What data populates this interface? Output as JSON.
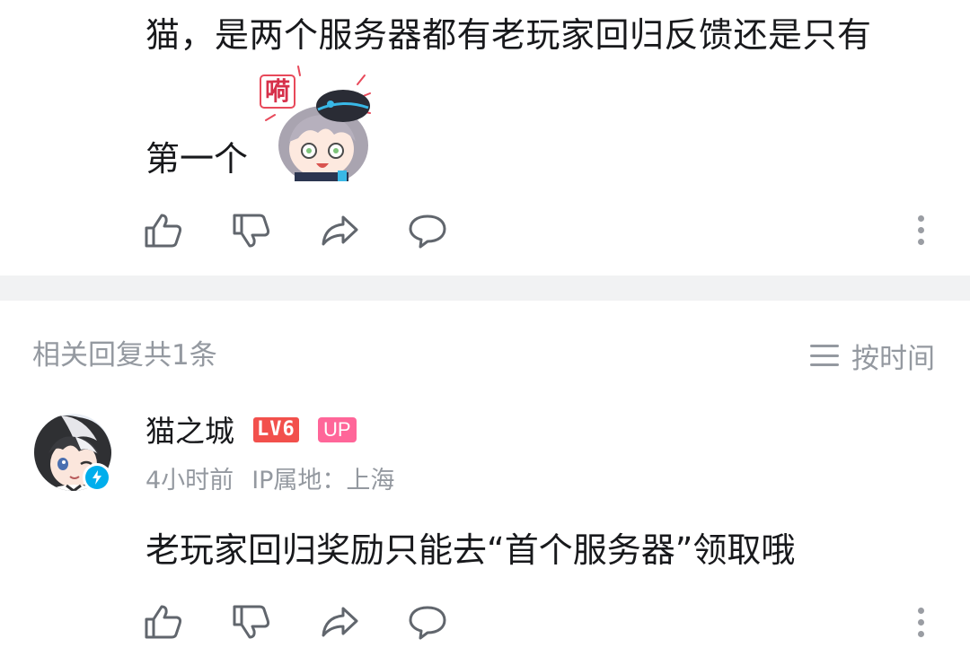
{
  "top_comment": {
    "line1": "猫，是两个服务器都有老玩家回归反馈还是只有",
    "line2": "第一个",
    "sticker_caption": "嗬"
  },
  "actions": {
    "like_icon": "thumbs-up-icon",
    "dislike_icon": "thumbs-down-icon",
    "share_icon": "share-icon",
    "comment_icon": "comment-icon",
    "more_icon": "more-vertical-icon"
  },
  "related": {
    "title": "相关回复共1条",
    "sort_label": "按时间",
    "sort_icon": "list-lines-icon"
  },
  "reply": {
    "username": "猫之城",
    "level_badge": "LV6",
    "up_badge": "UP",
    "time": "4小时前",
    "ip_location": "IP属地：上海",
    "text": "老玩家回归奖励只能去“首个服务器”领取哦"
  },
  "colors": {
    "text": "#18191c",
    "muted": "#9499a0",
    "divider": "#f1f2f3",
    "level_red": "#f2504c",
    "up_pink": "#ff6699",
    "verified_blue": "#00aeec"
  }
}
